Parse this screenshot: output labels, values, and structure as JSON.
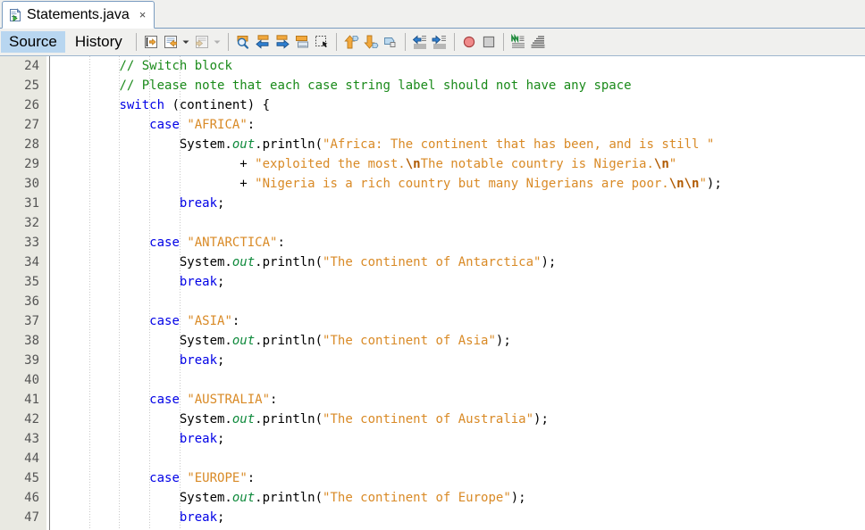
{
  "window": {
    "document_tab": {
      "title": "Statements.java",
      "icon": "java-file-icon",
      "close_label": "×"
    }
  },
  "view_tabs": [
    {
      "label": "Source",
      "active": true
    },
    {
      "label": "History",
      "active": false
    }
  ],
  "toolbar": {
    "groups": [
      {
        "buttons": [
          {
            "name": "toggle-bookmark-button",
            "icon": "toggle-bookmark-icon"
          },
          {
            "name": "previous-bookmark-button",
            "icon": "previous-bookmark-icon"
          },
          {
            "name": "previous-bookmark-dropdown",
            "icon": "chevron-down-icon"
          },
          {
            "name": "next-bookmark-button",
            "icon": "next-bookmark-icon"
          },
          {
            "name": "next-bookmark-dropdown",
            "icon": "chevron-down-icon"
          }
        ]
      },
      {
        "buttons": [
          {
            "name": "find-selection-button",
            "icon": "magnifier-icon"
          },
          {
            "name": "find-previous-button",
            "icon": "arrow-left-icon"
          },
          {
            "name": "find-next-button",
            "icon": "arrow-right-icon"
          },
          {
            "name": "toggle-highlight-search-button",
            "icon": "highlight-search-icon"
          },
          {
            "name": "toggle-rectangular-selection-button",
            "icon": "rectangular-selection-icon"
          }
        ]
      },
      {
        "buttons": [
          {
            "name": "previous-error-button",
            "icon": "arrow-up-tag-icon"
          },
          {
            "name": "next-error-button",
            "icon": "arrow-down-tag-icon"
          },
          {
            "name": "last-edit-button",
            "icon": "last-edit-tag-icon"
          }
        ]
      },
      {
        "buttons": [
          {
            "name": "shift-line-left-button",
            "icon": "shift-left-icon"
          },
          {
            "name": "shift-line-right-button",
            "icon": "shift-right-icon"
          }
        ]
      },
      {
        "buttons": [
          {
            "name": "start-macro-recording-button",
            "icon": "record-macro-icon"
          },
          {
            "name": "stop-macro-recording-button",
            "icon": "stop-macro-icon"
          }
        ]
      },
      {
        "buttons": [
          {
            "name": "toggle-non-printable-characters-button",
            "icon": "non-printable-chars-icon"
          },
          {
            "name": "toggle-text-limit-line-button",
            "icon": "text-limit-line-icon"
          }
        ]
      }
    ]
  },
  "editor": {
    "first_line_number": 24,
    "line_height_px": 22,
    "indent_guide_columns": [
      4,
      8,
      12,
      16
    ],
    "lines": [
      {
        "n": 24,
        "tokens": [
          {
            "t": "pln",
            "s": "        "
          },
          {
            "t": "cmt",
            "s": "// Switch block"
          }
        ]
      },
      {
        "n": 25,
        "tokens": [
          {
            "t": "pln",
            "s": "        "
          },
          {
            "t": "cmt",
            "s": "// Please note that each case string label should not have any space"
          }
        ]
      },
      {
        "n": 26,
        "tokens": [
          {
            "t": "pln",
            "s": "        "
          },
          {
            "t": "kw",
            "s": "switch"
          },
          {
            "t": "pln",
            "s": " (continent) {"
          }
        ]
      },
      {
        "n": 27,
        "tokens": [
          {
            "t": "pln",
            "s": "            "
          },
          {
            "t": "kw",
            "s": "case"
          },
          {
            "t": "pln",
            "s": " "
          },
          {
            "t": "str",
            "s": "\"AFRICA\""
          },
          {
            "t": "pln",
            "s": ":"
          }
        ]
      },
      {
        "n": 28,
        "tokens": [
          {
            "t": "pln",
            "s": "                System."
          },
          {
            "t": "fld",
            "s": "out"
          },
          {
            "t": "pln",
            "s": ".println("
          },
          {
            "t": "str",
            "s": "\"Africa: The continent that has been, and is still \""
          }
        ]
      },
      {
        "n": 29,
        "tokens": [
          {
            "t": "pln",
            "s": "                        + "
          },
          {
            "t": "str",
            "s": "\"exploited the most."
          },
          {
            "t": "esc",
            "s": "\\n"
          },
          {
            "t": "str",
            "s": "The notable country is Nigeria."
          },
          {
            "t": "esc",
            "s": "\\n"
          },
          {
            "t": "str",
            "s": "\""
          }
        ]
      },
      {
        "n": 30,
        "tokens": [
          {
            "t": "pln",
            "s": "                        + "
          },
          {
            "t": "str",
            "s": "\"Nigeria is a rich country but many Nigerians are poor."
          },
          {
            "t": "esc",
            "s": "\\n\\n"
          },
          {
            "t": "str",
            "s": "\""
          },
          {
            "t": "pln",
            "s": ");"
          }
        ]
      },
      {
        "n": 31,
        "tokens": [
          {
            "t": "pln",
            "s": "                "
          },
          {
            "t": "kw",
            "s": "break"
          },
          {
            "t": "pln",
            "s": ";"
          }
        ]
      },
      {
        "n": 32,
        "tokens": []
      },
      {
        "n": 33,
        "tokens": [
          {
            "t": "pln",
            "s": "            "
          },
          {
            "t": "kw",
            "s": "case"
          },
          {
            "t": "pln",
            "s": " "
          },
          {
            "t": "str",
            "s": "\"ANTARCTICA\""
          },
          {
            "t": "pln",
            "s": ":"
          }
        ]
      },
      {
        "n": 34,
        "tokens": [
          {
            "t": "pln",
            "s": "                System."
          },
          {
            "t": "fld",
            "s": "out"
          },
          {
            "t": "pln",
            "s": ".println("
          },
          {
            "t": "str",
            "s": "\"The continent of Antarctica\""
          },
          {
            "t": "pln",
            "s": ");"
          }
        ]
      },
      {
        "n": 35,
        "tokens": [
          {
            "t": "pln",
            "s": "                "
          },
          {
            "t": "kw",
            "s": "break"
          },
          {
            "t": "pln",
            "s": ";"
          }
        ]
      },
      {
        "n": 36,
        "tokens": []
      },
      {
        "n": 37,
        "tokens": [
          {
            "t": "pln",
            "s": "            "
          },
          {
            "t": "kw",
            "s": "case"
          },
          {
            "t": "pln",
            "s": " "
          },
          {
            "t": "str",
            "s": "\"ASIA\""
          },
          {
            "t": "pln",
            "s": ":"
          }
        ]
      },
      {
        "n": 38,
        "tokens": [
          {
            "t": "pln",
            "s": "                System."
          },
          {
            "t": "fld",
            "s": "out"
          },
          {
            "t": "pln",
            "s": ".println("
          },
          {
            "t": "str",
            "s": "\"The continent of Asia\""
          },
          {
            "t": "pln",
            "s": ");"
          }
        ]
      },
      {
        "n": 39,
        "tokens": [
          {
            "t": "pln",
            "s": "                "
          },
          {
            "t": "kw",
            "s": "break"
          },
          {
            "t": "pln",
            "s": ";"
          }
        ]
      },
      {
        "n": 40,
        "tokens": []
      },
      {
        "n": 41,
        "tokens": [
          {
            "t": "pln",
            "s": "            "
          },
          {
            "t": "kw",
            "s": "case"
          },
          {
            "t": "pln",
            "s": " "
          },
          {
            "t": "str",
            "s": "\"AUSTRALIA\""
          },
          {
            "t": "pln",
            "s": ":"
          }
        ]
      },
      {
        "n": 42,
        "tokens": [
          {
            "t": "pln",
            "s": "                System."
          },
          {
            "t": "fld",
            "s": "out"
          },
          {
            "t": "pln",
            "s": ".println("
          },
          {
            "t": "str",
            "s": "\"The continent of Australia\""
          },
          {
            "t": "pln",
            "s": ");"
          }
        ]
      },
      {
        "n": 43,
        "tokens": [
          {
            "t": "pln",
            "s": "                "
          },
          {
            "t": "kw",
            "s": "break"
          },
          {
            "t": "pln",
            "s": ";"
          }
        ]
      },
      {
        "n": 44,
        "tokens": []
      },
      {
        "n": 45,
        "tokens": [
          {
            "t": "pln",
            "s": "            "
          },
          {
            "t": "kw",
            "s": "case"
          },
          {
            "t": "pln",
            "s": " "
          },
          {
            "t": "str",
            "s": "\"EUROPE\""
          },
          {
            "t": "pln",
            "s": ":"
          }
        ]
      },
      {
        "n": 46,
        "tokens": [
          {
            "t": "pln",
            "s": "                System."
          },
          {
            "t": "fld",
            "s": "out"
          },
          {
            "t": "pln",
            "s": ".println("
          },
          {
            "t": "str",
            "s": "\"The continent of Europe\""
          },
          {
            "t": "pln",
            "s": ");"
          }
        ]
      },
      {
        "n": 47,
        "tokens": [
          {
            "t": "pln",
            "s": "                "
          },
          {
            "t": "kw",
            "s": "break"
          },
          {
            "t": "pln",
            "s": ";"
          }
        ]
      }
    ]
  },
  "colors": {
    "comment": "#1a8a1a",
    "keyword": "#0000e6",
    "string": "#d98a26",
    "escape": "#b05a00",
    "field": "#0f8a3c",
    "plain": "#000000",
    "gutter_bg": "#e9e9e2",
    "chrome_bg": "#f0f0ee",
    "active_tab_bg": "#b8d6f0",
    "tab_border": "#7a9cc0"
  }
}
